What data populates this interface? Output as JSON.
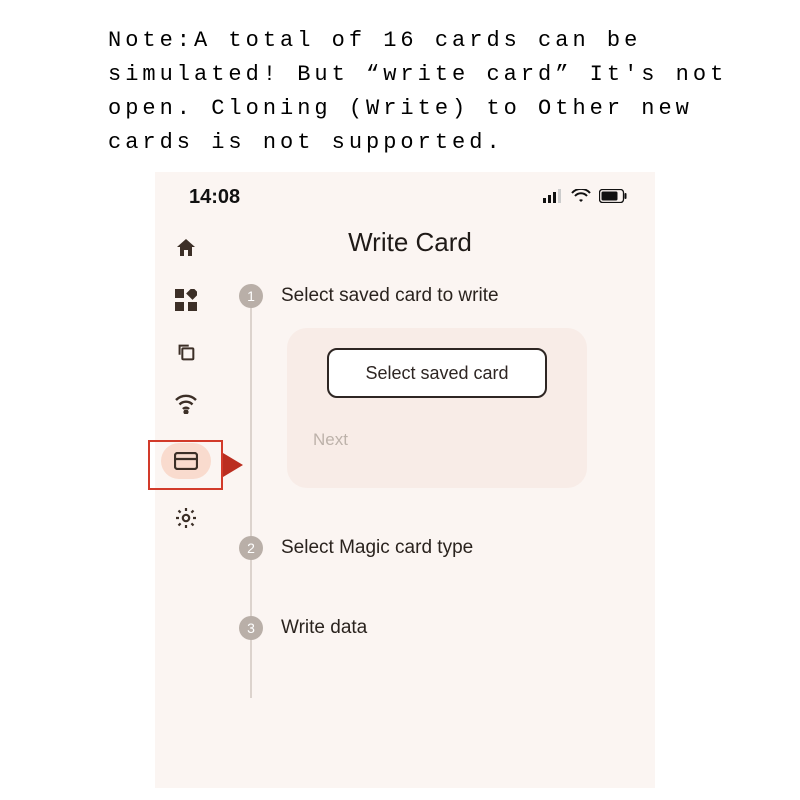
{
  "note": "Note:A total of 16 cards can be simulated! But “write card” It's not open. Cloning (Write) to Other new cards is not supported.",
  "status": {
    "time": "14:08"
  },
  "title": "Write Card",
  "steps": {
    "s1": {
      "num": "1",
      "label": "Select saved card to write"
    },
    "s2": {
      "num": "2",
      "label": "Select Magic card type"
    },
    "s3": {
      "num": "3",
      "label": "Write data"
    }
  },
  "select": {
    "button": "Select saved card",
    "next": "Next"
  }
}
